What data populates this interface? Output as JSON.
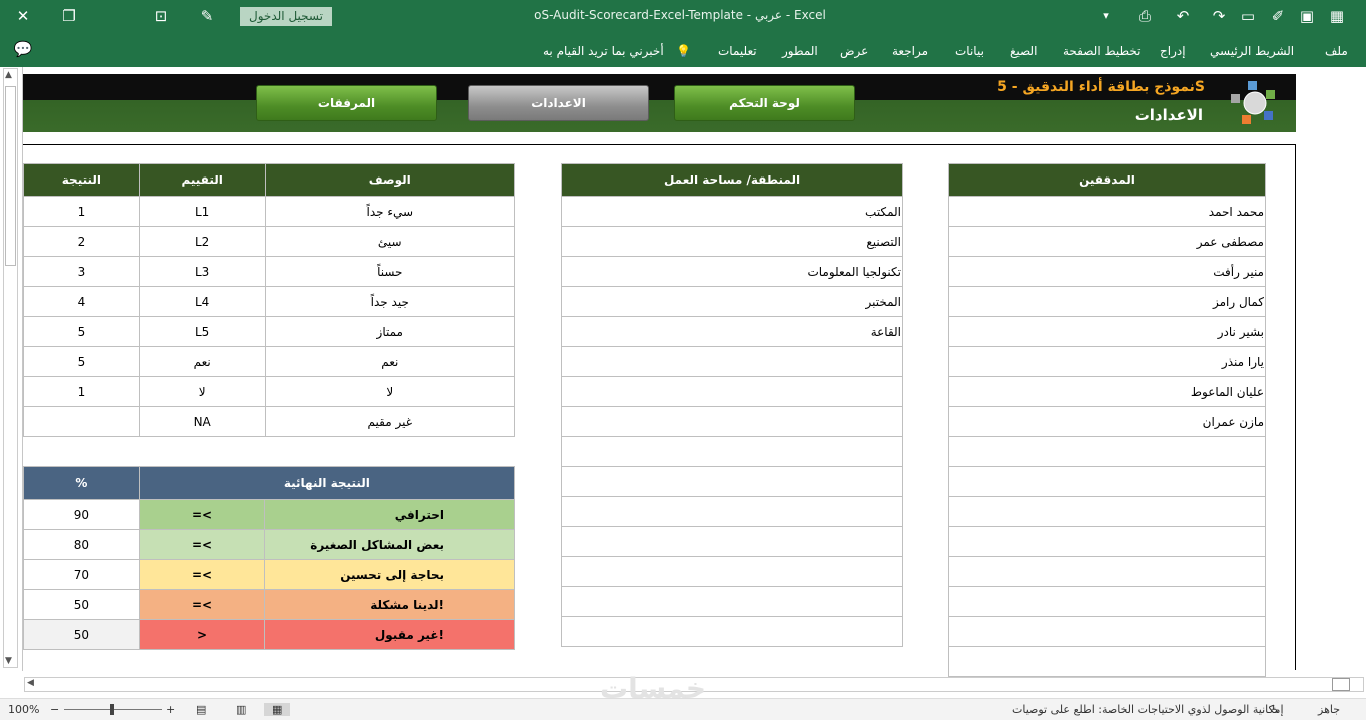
{
  "window": {
    "title": "oS-Audit-Scorecard-Excel-Template  -  عربي  -  Excel",
    "signin": "تسجيل الدخول"
  },
  "ribbon": {
    "tabs": [
      "ملف",
      "الشريط الرئيسي",
      "إدراج",
      "تخطيط الصفحة",
      "الصيغ",
      "بيانات",
      "مراجعة",
      "عرض",
      "المطور",
      "تعليمات"
    ],
    "tellme": "أخبرني بما تريد القيام به"
  },
  "header": {
    "title": "نموذج بطاقة أداء التدقيق - 5S",
    "subtitle": "الاعدادات",
    "buttons": {
      "dashboard": "لوحة التحكم",
      "settings": "الاعدادات",
      "attachments": "المرفقات"
    }
  },
  "auditors": {
    "header": "المدققين",
    "rows": [
      "محمد احمد",
      "مصطفى عمر",
      "منير رأفت",
      "كمال رامز",
      "بشير نادر",
      "يارا منذر",
      "عليان الماعوط",
      "مازن عمران",
      "",
      "",
      "",
      "",
      "",
      "",
      "",
      ""
    ]
  },
  "areas": {
    "header": "المنطقة/ مساحة العمل",
    "rows": [
      "المكتب",
      "التصنيع",
      "تكنولجيا المعلومات",
      "المختبر",
      "القاعة",
      "",
      "",
      "",
      "",
      "",
      "",
      "",
      "",
      "",
      ""
    ]
  },
  "ratings": {
    "headers": {
      "result": "النتيجة",
      "rating": "التقييم",
      "description": "الوصف"
    },
    "rows": [
      {
        "result": "1",
        "rating": "L1",
        "description": "سيء جداً"
      },
      {
        "result": "2",
        "rating": "L2",
        "description": "سيئ"
      },
      {
        "result": "3",
        "rating": "L3",
        "description": "حسناً"
      },
      {
        "result": "4",
        "rating": "L4",
        "description": "جيد جداً"
      },
      {
        "result": "5",
        "rating": "L5",
        "description": "ممتاز"
      },
      {
        "result": "5",
        "rating": "نعم",
        "description": "نعم"
      },
      {
        "result": "1",
        "rating": "لا",
        "description": "لا"
      },
      {
        "result": "",
        "rating": "NA",
        "description": "غير مقيم"
      }
    ]
  },
  "final": {
    "headers": {
      "percent": "%",
      "label": "النتيجة النهائية"
    },
    "rows": [
      {
        "value": "90",
        "op": "=<",
        "label": "احترافي",
        "color": "#a9d08e"
      },
      {
        "value": "80",
        "op": "=<",
        "label": "بعض المشاكل الصغيرة",
        "color": "#c6e0b4"
      },
      {
        "value": "70",
        "op": "=<",
        "label": "بحاجة إلى تحسين",
        "color": "#ffe699"
      },
      {
        "value": "50",
        "op": "=<",
        "label": "لدينا مشكلة!",
        "color": "#f4b183"
      },
      {
        "value": "50",
        "op": ">",
        "label": "غير مقبول!",
        "color": "#f4726b"
      }
    ]
  },
  "status": {
    "ready": "جاهز",
    "accessibility": "إمكانية الوصول لذوي الاحتياجات الخاصة: اطلع على توصيات",
    "zoom": "100%"
  },
  "watermark": "خمسات"
}
